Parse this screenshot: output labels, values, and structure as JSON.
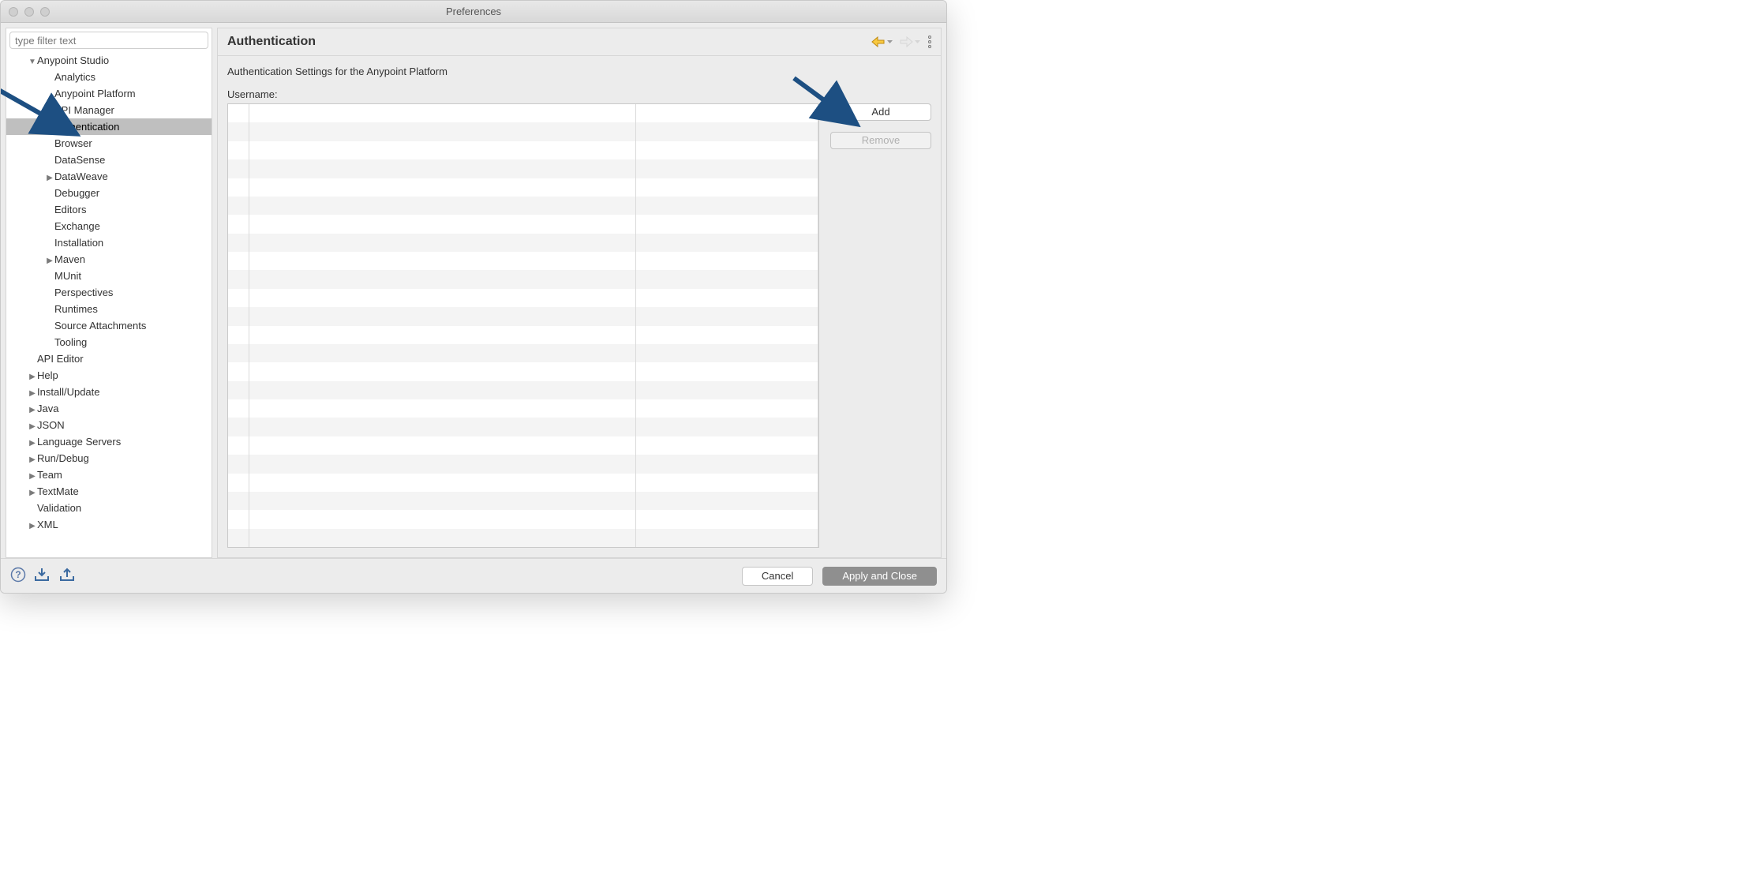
{
  "window": {
    "title": "Preferences"
  },
  "sidebar": {
    "filter_placeholder": "type filter text",
    "items": [
      {
        "label": "Anypoint Studio",
        "level": 1,
        "expanded": true,
        "children": true,
        "selected": false
      },
      {
        "label": "Analytics",
        "level": 2,
        "children": false,
        "selected": false
      },
      {
        "label": "Anypoint Platform",
        "level": 2,
        "children": false,
        "selected": false
      },
      {
        "label": "API Manager",
        "level": 2,
        "children": false,
        "selected": false
      },
      {
        "label": "Authentication",
        "level": 2,
        "children": false,
        "selected": true
      },
      {
        "label": "Browser",
        "level": 2,
        "children": false,
        "selected": false
      },
      {
        "label": "DataSense",
        "level": 2,
        "children": false,
        "selected": false
      },
      {
        "label": "DataWeave",
        "level": 2,
        "children": true,
        "expanded": false,
        "selected": false
      },
      {
        "label": "Debugger",
        "level": 2,
        "children": false,
        "selected": false
      },
      {
        "label": "Editors",
        "level": 2,
        "children": false,
        "selected": false
      },
      {
        "label": "Exchange",
        "level": 2,
        "children": false,
        "selected": false
      },
      {
        "label": "Installation",
        "level": 2,
        "children": false,
        "selected": false
      },
      {
        "label": "Maven",
        "level": 2,
        "children": true,
        "expanded": false,
        "selected": false
      },
      {
        "label": "MUnit",
        "level": 2,
        "children": false,
        "selected": false
      },
      {
        "label": "Perspectives",
        "level": 2,
        "children": false,
        "selected": false
      },
      {
        "label": "Runtimes",
        "level": 2,
        "children": false,
        "selected": false
      },
      {
        "label": "Source Attachments",
        "level": 2,
        "children": false,
        "selected": false
      },
      {
        "label": "Tooling",
        "level": 2,
        "children": false,
        "selected": false
      },
      {
        "label": "API Editor",
        "level": 1,
        "children": false,
        "selected": false
      },
      {
        "label": "Help",
        "level": 1,
        "children": true,
        "expanded": false,
        "selected": false
      },
      {
        "label": "Install/Update",
        "level": 1,
        "children": true,
        "expanded": false,
        "selected": false
      },
      {
        "label": "Java",
        "level": 1,
        "children": true,
        "expanded": false,
        "selected": false
      },
      {
        "label": "JSON",
        "level": 1,
        "children": true,
        "expanded": false,
        "selected": false
      },
      {
        "label": "Language Servers",
        "level": 1,
        "children": true,
        "expanded": false,
        "selected": false
      },
      {
        "label": "Run/Debug",
        "level": 1,
        "children": true,
        "expanded": false,
        "selected": false
      },
      {
        "label": "Team",
        "level": 1,
        "children": true,
        "expanded": false,
        "selected": false
      },
      {
        "label": "TextMate",
        "level": 1,
        "children": true,
        "expanded": false,
        "selected": false
      },
      {
        "label": "Validation",
        "level": 1,
        "children": false,
        "selected": false
      },
      {
        "label": "XML",
        "level": 1,
        "children": true,
        "expanded": false,
        "selected": false
      }
    ]
  },
  "main": {
    "heading": "Authentication",
    "subtitle": "Authentication Settings for the Anypoint Platform",
    "username_label": "Username:",
    "buttons": {
      "add": "Add",
      "remove": "Remove"
    }
  },
  "footer": {
    "cancel": "Cancel",
    "apply_close": "Apply and Close"
  }
}
